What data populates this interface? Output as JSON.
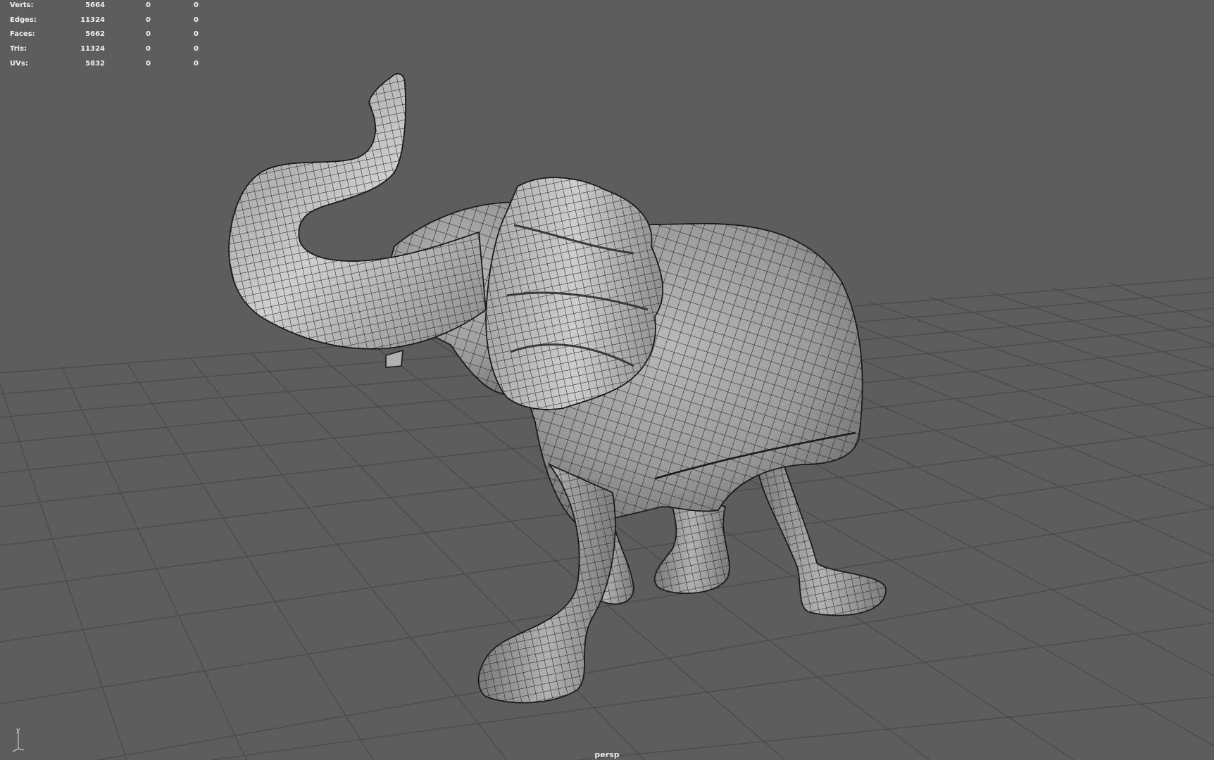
{
  "viewport": {
    "camera": "persp",
    "axis_y": "y"
  },
  "hud": {
    "rows": [
      {
        "label": "Verts:",
        "total": "5664",
        "selected": "0",
        "highlighted": "0"
      },
      {
        "label": "Edges:",
        "total": "11324",
        "selected": "0",
        "highlighted": "0"
      },
      {
        "label": "Faces:",
        "total": "5662",
        "selected": "0",
        "highlighted": "0"
      },
      {
        "label": "Tris:",
        "total": "11324",
        "selected": "0",
        "highlighted": "0"
      },
      {
        "label": "UVs:",
        "total": "5832",
        "selected": "0",
        "highlighted": "0"
      }
    ]
  },
  "colors": {
    "background": "#5d5d5d",
    "grid": "#4a4a4a",
    "mesh_fill": "#9a9a9a",
    "wire": "#1a1a1a"
  }
}
